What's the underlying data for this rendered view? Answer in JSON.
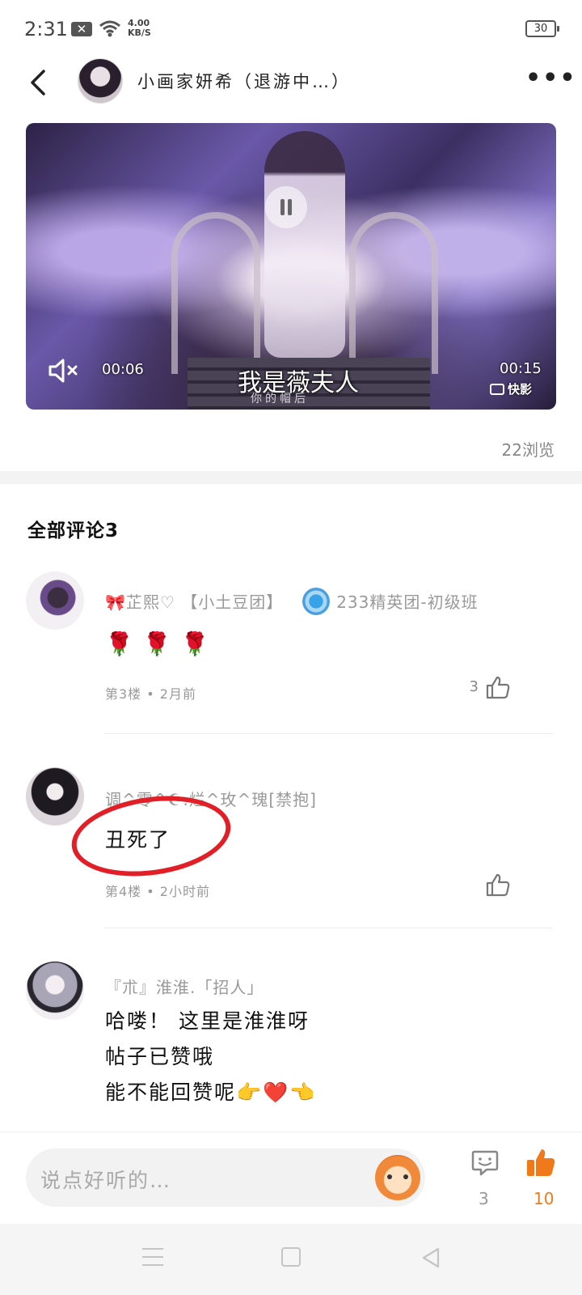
{
  "status_bar": {
    "time": "2:31",
    "notification_icon": "close-box-icon",
    "net_speed_value": "4.00",
    "net_speed_unit": "KB/S",
    "battery": "30"
  },
  "header": {
    "title": "小画家妍希（退游中…）",
    "back_icon": "chevron-left-icon",
    "more_label": "•••"
  },
  "video": {
    "current_time": "00:06",
    "duration": "00:15",
    "subtitle": "我是薇夫人",
    "subtitle_small": "你的帽后",
    "brand": "快影",
    "state": "playing"
  },
  "views": "22浏览",
  "comments_section": {
    "title": "全部评论3",
    "comments": [
      {
        "name": "芷熙♡  【小土豆团】",
        "badge_text": "233精英团-初级班",
        "body_icons": [
          "rose-icon",
          "rose-icon",
          "rose-icon"
        ],
        "meta": "第3楼 • 2月前",
        "likes": "3"
      },
      {
        "name": "调^零^☪.烂^玫^瑰[禁抱]",
        "body": "丑死了",
        "meta": "第4楼 • 2小时前",
        "likes": ""
      },
      {
        "name": "『朮』淮淮.「招人」",
        "body_lines": [
          "哈喽！ 这里是淮淮呀",
          "帖子已赞哦",
          "能不能回赞呢👉❤️👈"
        ]
      }
    ]
  },
  "bottom_bar": {
    "input_placeholder": "说点好听的…",
    "comment_count": "3",
    "like_count": "10",
    "accent_color": "#f07a1a"
  }
}
